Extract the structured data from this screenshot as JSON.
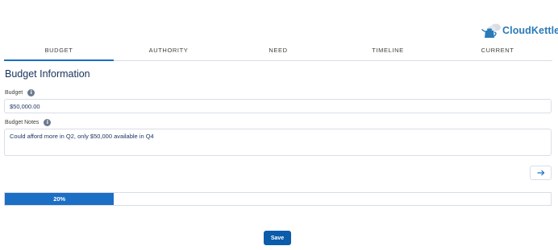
{
  "brand": {
    "name": "CloudKettle",
    "accent": "#2a7ab8"
  },
  "tabs": [
    {
      "label": "BUDGET",
      "active": true
    },
    {
      "label": "AUTHORITY",
      "active": false
    },
    {
      "label": "NEED",
      "active": false
    },
    {
      "label": "TIMELINE",
      "active": false
    },
    {
      "label": "CURRENT",
      "active": false
    }
  ],
  "section": {
    "title": "Budget Information"
  },
  "fields": {
    "budget": {
      "label": "Budget",
      "value": "$50,000.00",
      "info_icon": "info-icon"
    },
    "budget_notes": {
      "label": "Budget Notes",
      "value": "Could afford more in Q2, only $50,000 available in Q4",
      "info_icon": "info-icon"
    }
  },
  "next": {
    "icon": "arrow-right-icon"
  },
  "progress": {
    "label": "20%",
    "value": 0.2,
    "color": "#1b6fc4"
  },
  "save": {
    "label": "Save",
    "color": "#0b5cab"
  }
}
